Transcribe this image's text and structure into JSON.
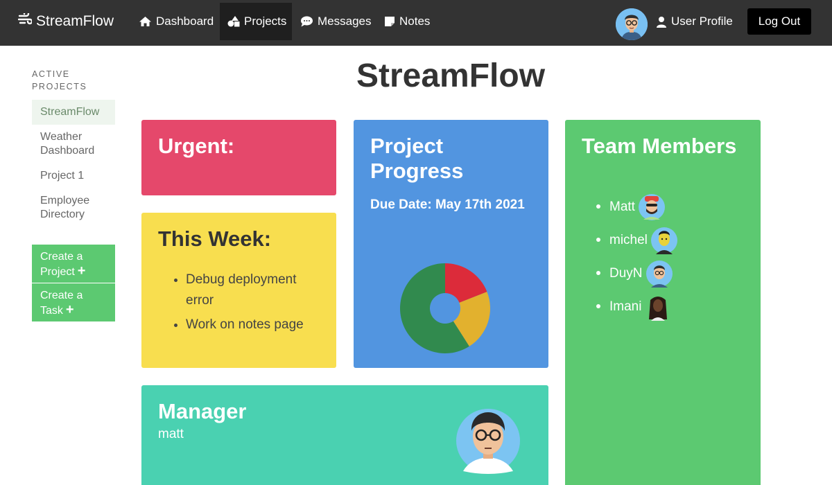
{
  "navbar": {
    "brand": "StreamFlow",
    "links": [
      {
        "label": "Dashboard",
        "icon": "home-icon"
      },
      {
        "label": "Projects",
        "icon": "shapes-icon",
        "active": true
      },
      {
        "label": "Messages",
        "icon": "chat-icon"
      },
      {
        "label": "Notes",
        "icon": "note-icon"
      }
    ],
    "profile_label": "User Profile",
    "logout_label": "Log Out"
  },
  "sidebar": {
    "heading": "ACTIVE PROJECTS",
    "items": [
      {
        "label": "StreamFlow",
        "active": true
      },
      {
        "label": "Weather Dashboard"
      },
      {
        "label": "Project 1"
      },
      {
        "label": "Employee Directory"
      }
    ],
    "create_project": "Create a Project",
    "create_task": "Create a Task"
  },
  "page": {
    "title": "StreamFlow"
  },
  "urgent": {
    "title": "Urgent:"
  },
  "this_week": {
    "title": "This Week:",
    "tasks": [
      "Debug deployment error",
      "Work on notes page"
    ]
  },
  "progress": {
    "title": "Project Progress",
    "due": "Due Date: May 17th 2021",
    "segments": [
      {
        "value": 0.19,
        "color": "#dc2b3a"
      },
      {
        "value": 0.22,
        "color": "#e2b12e"
      },
      {
        "value": 0.59,
        "color": "#318a4e"
      }
    ]
  },
  "team": {
    "title": "Team Members",
    "members": [
      "Matt",
      "michel",
      "DuyN",
      "Imani"
    ]
  },
  "manager": {
    "title": "Manager",
    "name": "matt"
  },
  "colors": {
    "navbar": "#333333",
    "urgent": "#e5486b",
    "week": "#f8de4f",
    "progress": "#5295e0",
    "team": "#5cc971",
    "manager": "#4ad1b1"
  }
}
